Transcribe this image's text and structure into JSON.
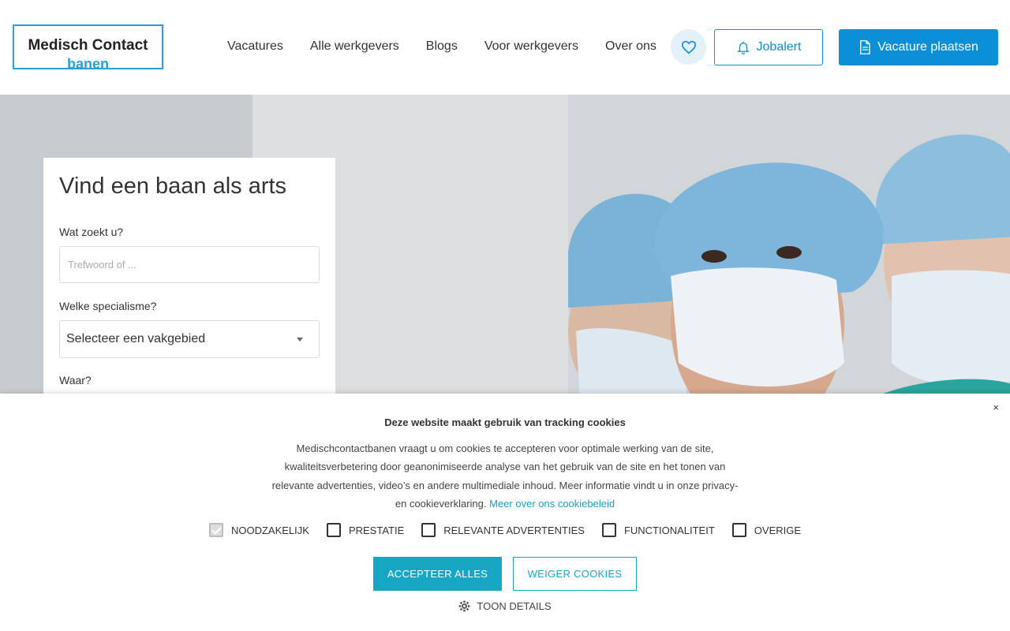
{
  "header": {
    "logo": {
      "line1": "Medisch Contact",
      "line2": "banen"
    },
    "nav": [
      {
        "label": "Vacatures"
      },
      {
        "label": "Alle werkgevers"
      },
      {
        "label": "Blogs"
      },
      {
        "label": "Voor werkgevers"
      },
      {
        "label": "Over ons"
      }
    ],
    "favorites_icon": "heart-icon",
    "jobalert_label": "Jobalert",
    "post_vacancy_label": "Vacature plaatsen"
  },
  "search": {
    "title": "Vind een baan als arts",
    "keyword_label": "Wat zoekt u?",
    "keyword_placeholder": "Trefwoord of ...",
    "specialism_label": "Welke specialisme?",
    "specialism_value": "Selecteer een vakgebied",
    "location_label": "Waar?"
  },
  "cookie": {
    "title": "Deze website maakt gebruik van tracking cookies",
    "text": "Medischcontactbanen vraagt u om cookies te accepteren voor optimale werking van de site, kwaliteitsverbetering door geanonimiseerde analyse van het gebruik van de site en het tonen van relevante advertenties, video’s en andere multimediale inhoud. Meer informatie vindt u in onze privacy- en cookieverklaring.",
    "link": "Meer over ons cookiebeleid",
    "close": "×",
    "options": [
      {
        "label": "NOODZAKELIJK",
        "checked": true
      },
      {
        "label": "PRESTATIE",
        "checked": false
      },
      {
        "label": "RELEVANTE ADVERTENTIES",
        "checked": false
      },
      {
        "label": "FUNCTIONALITEIT",
        "checked": false
      },
      {
        "label": "OVERIGE",
        "checked": false
      }
    ],
    "accept_label": "ACCEPTEER ALLES",
    "deny_label": "WEIGER COOKIES",
    "details_label": "TOON DETAILS"
  },
  "colors": {
    "brand": "#0b8fd8",
    "cookie_accent": "#17a6c4",
    "scrub_teal": "#2aa59d"
  }
}
